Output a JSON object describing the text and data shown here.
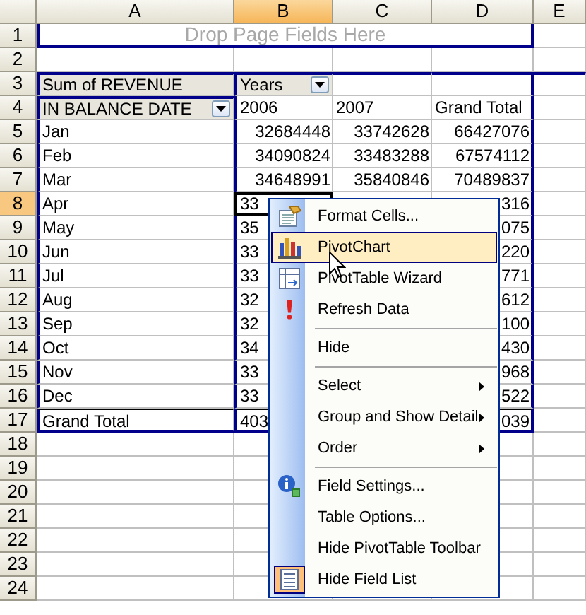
{
  "columns": [
    {
      "label": "A",
      "selected": false
    },
    {
      "label": "B",
      "selected": true
    },
    {
      "label": "C",
      "selected": false
    },
    {
      "label": "D",
      "selected": false
    },
    {
      "label": "E",
      "selected": false
    }
  ],
  "rows": [
    {
      "number": "1",
      "selected": false,
      "kind": "drop-zone",
      "cells": {
        "a": "Drop Page Fields Here"
      }
    },
    {
      "number": "2",
      "selected": false,
      "kind": "blank",
      "cells": {}
    },
    {
      "number": "3",
      "selected": false,
      "kind": "fields",
      "cells": {
        "a": {
          "text": "Sum of REVENUE",
          "dropdown": false
        },
        "b": {
          "text": "Years",
          "dropdown": true
        }
      }
    },
    {
      "number": "4",
      "selected": false,
      "kind": "labels",
      "cells": {
        "a": {
          "text": "IN BALANCE DATE",
          "dropdown": true
        },
        "b": "2006",
        "c": "2007",
        "d": "Grand Total"
      }
    },
    {
      "number": "5",
      "selected": false,
      "kind": "data",
      "cells": {
        "a": "Jan",
        "b": "32684448",
        "c": "33742628",
        "d": "66427076"
      }
    },
    {
      "number": "6",
      "selected": false,
      "kind": "data",
      "cells": {
        "a": "Feb",
        "b": "34090824",
        "c": "33483288",
        "d": "67574112"
      }
    },
    {
      "number": "7",
      "selected": false,
      "kind": "data",
      "cells": {
        "a": "Mar",
        "b": "34648991",
        "c": "35840846",
        "d": "70489837"
      }
    },
    {
      "number": "8",
      "selected": true,
      "kind": "data",
      "cells": {
        "a": "Apr",
        "b": {
          "text": "33",
          "cut": true
        },
        "d": "316"
      }
    },
    {
      "number": "9",
      "selected": false,
      "kind": "data",
      "cells": {
        "a": "May",
        "b": {
          "text": "35",
          "cut": true
        },
        "d": "075"
      }
    },
    {
      "number": "10",
      "selected": false,
      "kind": "data",
      "cells": {
        "a": "Jun",
        "b": {
          "text": "33",
          "cut": true
        },
        "d": "220"
      }
    },
    {
      "number": "11",
      "selected": false,
      "kind": "data",
      "cells": {
        "a": "Jul",
        "b": {
          "text": "33",
          "cut": true
        },
        "d": "771"
      }
    },
    {
      "number": "12",
      "selected": false,
      "kind": "data",
      "cells": {
        "a": "Aug",
        "b": {
          "text": "32",
          "cut": true
        },
        "d": "612"
      }
    },
    {
      "number": "13",
      "selected": false,
      "kind": "data",
      "cells": {
        "a": "Sep",
        "b": {
          "text": "32",
          "cut": true
        },
        "d": "100"
      }
    },
    {
      "number": "14",
      "selected": false,
      "kind": "data",
      "cells": {
        "a": "Oct",
        "b": {
          "text": "34",
          "cut": true
        },
        "d": "430"
      }
    },
    {
      "number": "15",
      "selected": false,
      "kind": "data",
      "cells": {
        "a": "Nov",
        "b": {
          "text": "33",
          "cut": true
        },
        "d": "968"
      }
    },
    {
      "number": "16",
      "selected": false,
      "kind": "data",
      "cells": {
        "a": "Dec",
        "b": {
          "text": "33",
          "cut": true
        },
        "d": "522"
      }
    },
    {
      "number": "17",
      "selected": false,
      "kind": "total",
      "cells": {
        "a": "Grand Total",
        "b": {
          "text": "403",
          "cut": true
        },
        "d": "039"
      }
    },
    {
      "number": "18",
      "selected": false,
      "kind": "blank",
      "cells": {}
    },
    {
      "number": "19",
      "selected": false,
      "kind": "blank",
      "cells": {}
    },
    {
      "number": "20",
      "selected": false,
      "kind": "blank",
      "cells": {}
    },
    {
      "number": "21",
      "selected": false,
      "kind": "blank",
      "cells": {}
    },
    {
      "number": "22",
      "selected": false,
      "kind": "blank",
      "cells": {}
    },
    {
      "number": "23",
      "selected": false,
      "kind": "blank",
      "cells": {}
    },
    {
      "number": "24",
      "selected": false,
      "kind": "blank",
      "cells": {}
    }
  ],
  "menu": {
    "items": [
      {
        "kind": "item",
        "label": "Format Cells...",
        "selected": false,
        "checked": false
      },
      {
        "kind": "item",
        "label": "PivotChart",
        "selected": true,
        "checked": false
      },
      {
        "kind": "item",
        "label": "PivotTable Wizard",
        "selected": false,
        "checked": false
      },
      {
        "kind": "item",
        "label": "Refresh Data",
        "selected": false,
        "checked": false
      },
      {
        "kind": "separator"
      },
      {
        "kind": "item",
        "label": "Hide",
        "selected": false,
        "checked": false
      },
      {
        "kind": "separator"
      },
      {
        "kind": "submenu",
        "label": "Select",
        "selected": false,
        "checked": false
      },
      {
        "kind": "submenu",
        "label": "Group and Show Detail",
        "selected": false,
        "checked": false
      },
      {
        "kind": "submenu",
        "label": "Order",
        "selected": false,
        "checked": false
      },
      {
        "kind": "separator"
      },
      {
        "kind": "item",
        "label": "Field Settings...",
        "selected": false,
        "checked": false
      },
      {
        "kind": "item",
        "label": "Table Options...",
        "selected": false,
        "checked": false
      },
      {
        "kind": "item",
        "label": "Hide PivotTable Toolbar",
        "selected": false,
        "checked": false
      },
      {
        "kind": "item",
        "label": "Hide Field List",
        "selected": false,
        "checked": true
      }
    ]
  }
}
